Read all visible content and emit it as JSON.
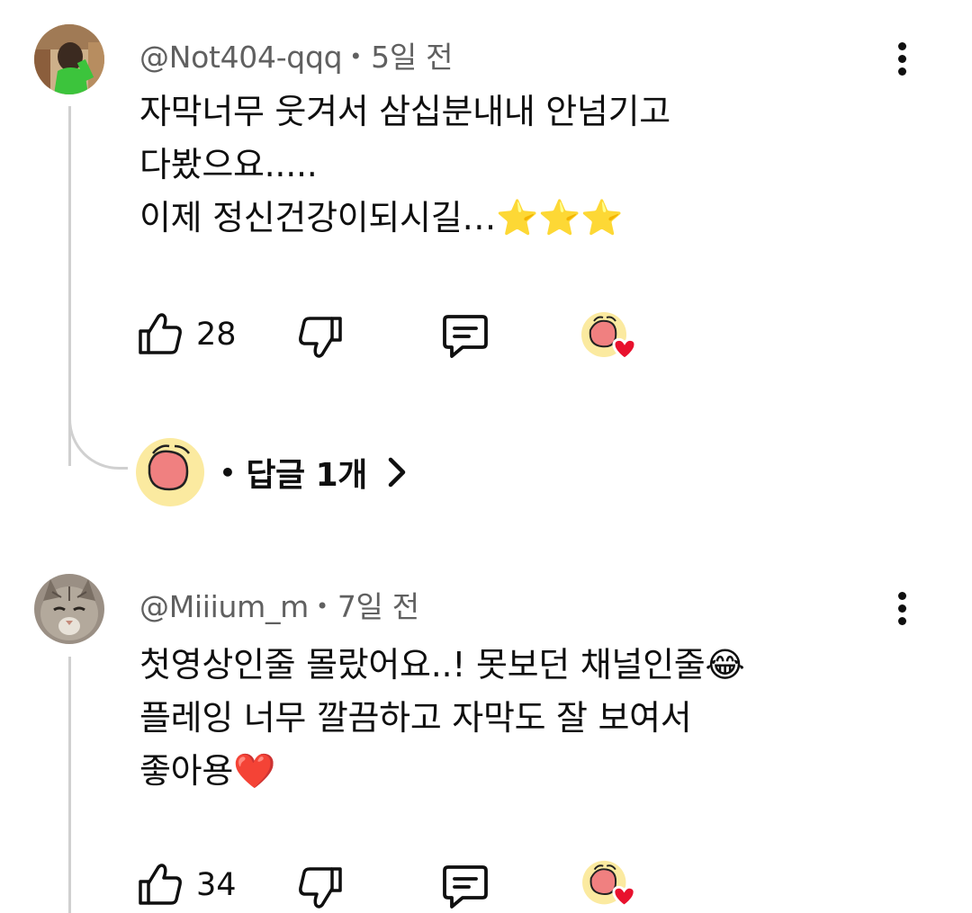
{
  "comments": [
    {
      "author": "@Not404-qqq",
      "time": "5일 전",
      "lines": [
        "자막너무 웃겨서 삼십분내내 안넘기고",
        "다봤으요.....",
        "이제 정신건강이되시길…⭐⭐⭐"
      ],
      "likes": "28",
      "replies_label": "답글 1개"
    },
    {
      "author": "@Miiium_m",
      "time": "7일 전",
      "lines": [
        "첫영상인줄 몰랐어요..! 못보던 채널인줄😂",
        "플레잉 너무 깔끔하고 자막도 잘 보여서",
        "좋아용❤️"
      ],
      "likes": "34"
    }
  ],
  "separator": "•",
  "icons": {
    "like": "thumbs-up-icon",
    "dislike": "thumbs-down-icon",
    "reply": "comment-icon",
    "creator_heart": "creator-heart-icon",
    "more": "more-vertical-icon",
    "chevron": "chevron-right-icon"
  },
  "colors": {
    "text": "#0f0f0f",
    "meta": "#606060",
    "heart": "#e8112d",
    "creator_avatar_bg": "#fbeaa0",
    "creator_mouth": "#f08080"
  }
}
